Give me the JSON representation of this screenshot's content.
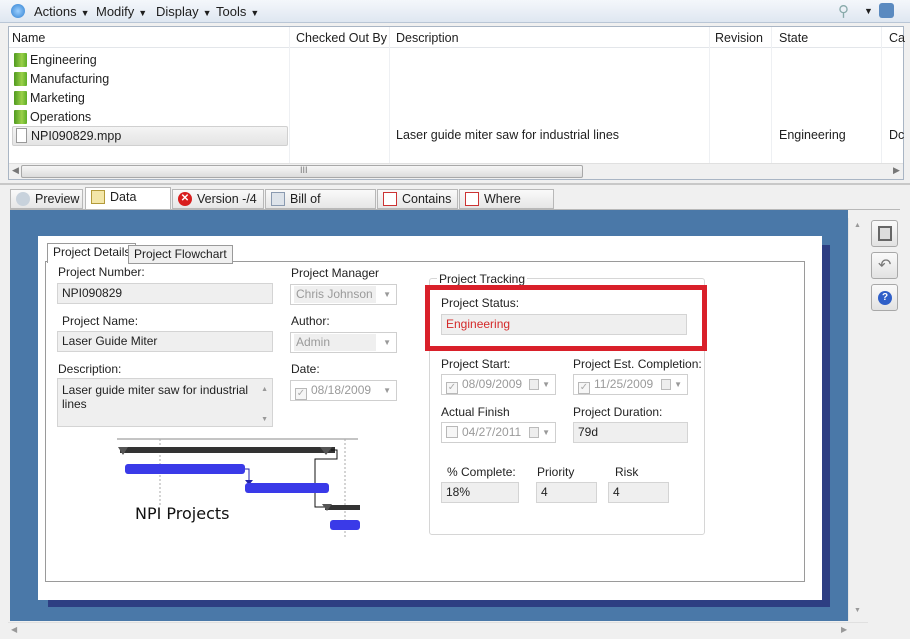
{
  "toolbar": {
    "menus": [
      "Actions",
      "Modify",
      "Display",
      "Tools"
    ],
    "icons": [
      "refresh-icon",
      "search-icon",
      "help-icon"
    ]
  },
  "list": {
    "columns": [
      "Name",
      "Checked Out By",
      "Description",
      "Revision",
      "State",
      "Ca"
    ],
    "rows": [
      {
        "name": "Engineering",
        "type": "folder",
        "description": "",
        "state": "",
        "ca": ""
      },
      {
        "name": "Manufacturing",
        "type": "folder",
        "description": "",
        "state": "",
        "ca": ""
      },
      {
        "name": "Marketing",
        "type": "folder",
        "description": "",
        "state": "",
        "ca": ""
      },
      {
        "name": "Operations",
        "type": "folder",
        "description": "",
        "state": "",
        "ca": ""
      },
      {
        "name": "NPI090829.mpp",
        "type": "file",
        "description": "Laser guide miter saw for industrial lines",
        "state": "Engineering",
        "ca": "Dc"
      }
    ],
    "scroll_grip": "III"
  },
  "tabs": [
    "Preview",
    "Data Card",
    "Version -/4",
    "Bill of Materials",
    "Contains",
    "Where Used"
  ],
  "active_tab": "Data Card",
  "card": {
    "inner_tabs": [
      "Project Details",
      "Project Flowchart"
    ],
    "project_number_label": "Project Number:",
    "project_number": "NPI090829",
    "project_name_label": "Project Name:",
    "project_name": "Laser Guide Miter",
    "description_label": "Description:",
    "description": "Laser guide miter saw for industrial lines",
    "project_manager_label": "Project Manager",
    "project_manager": "Chris Johnson",
    "author_label": "Author:",
    "author": "Admin",
    "date_label": "Date:",
    "date": "08/18/2009",
    "logo_text": "NPI Projects",
    "tracking": {
      "group_label": "Project Tracking",
      "status_label": "Project Status:",
      "status": "Engineering",
      "status_color": "#d42a2a",
      "highlight_color": "#d9202a",
      "start_label": "Project Start:",
      "start": "08/09/2009",
      "est_completion_label": "Project Est. Completion:",
      "est_completion": "11/25/2009",
      "actual_finish_label": "Actual Finish",
      "actual_finish": "04/27/2011",
      "duration_label": "Project Duration:",
      "duration": "79d",
      "complete_label": "% Complete:",
      "complete": "18%",
      "priority_label": "Priority",
      "priority": "4",
      "risk_label": "Risk",
      "risk": "4"
    }
  },
  "side_buttons": [
    "save-icon",
    "undo-icon",
    "help-icon"
  ]
}
